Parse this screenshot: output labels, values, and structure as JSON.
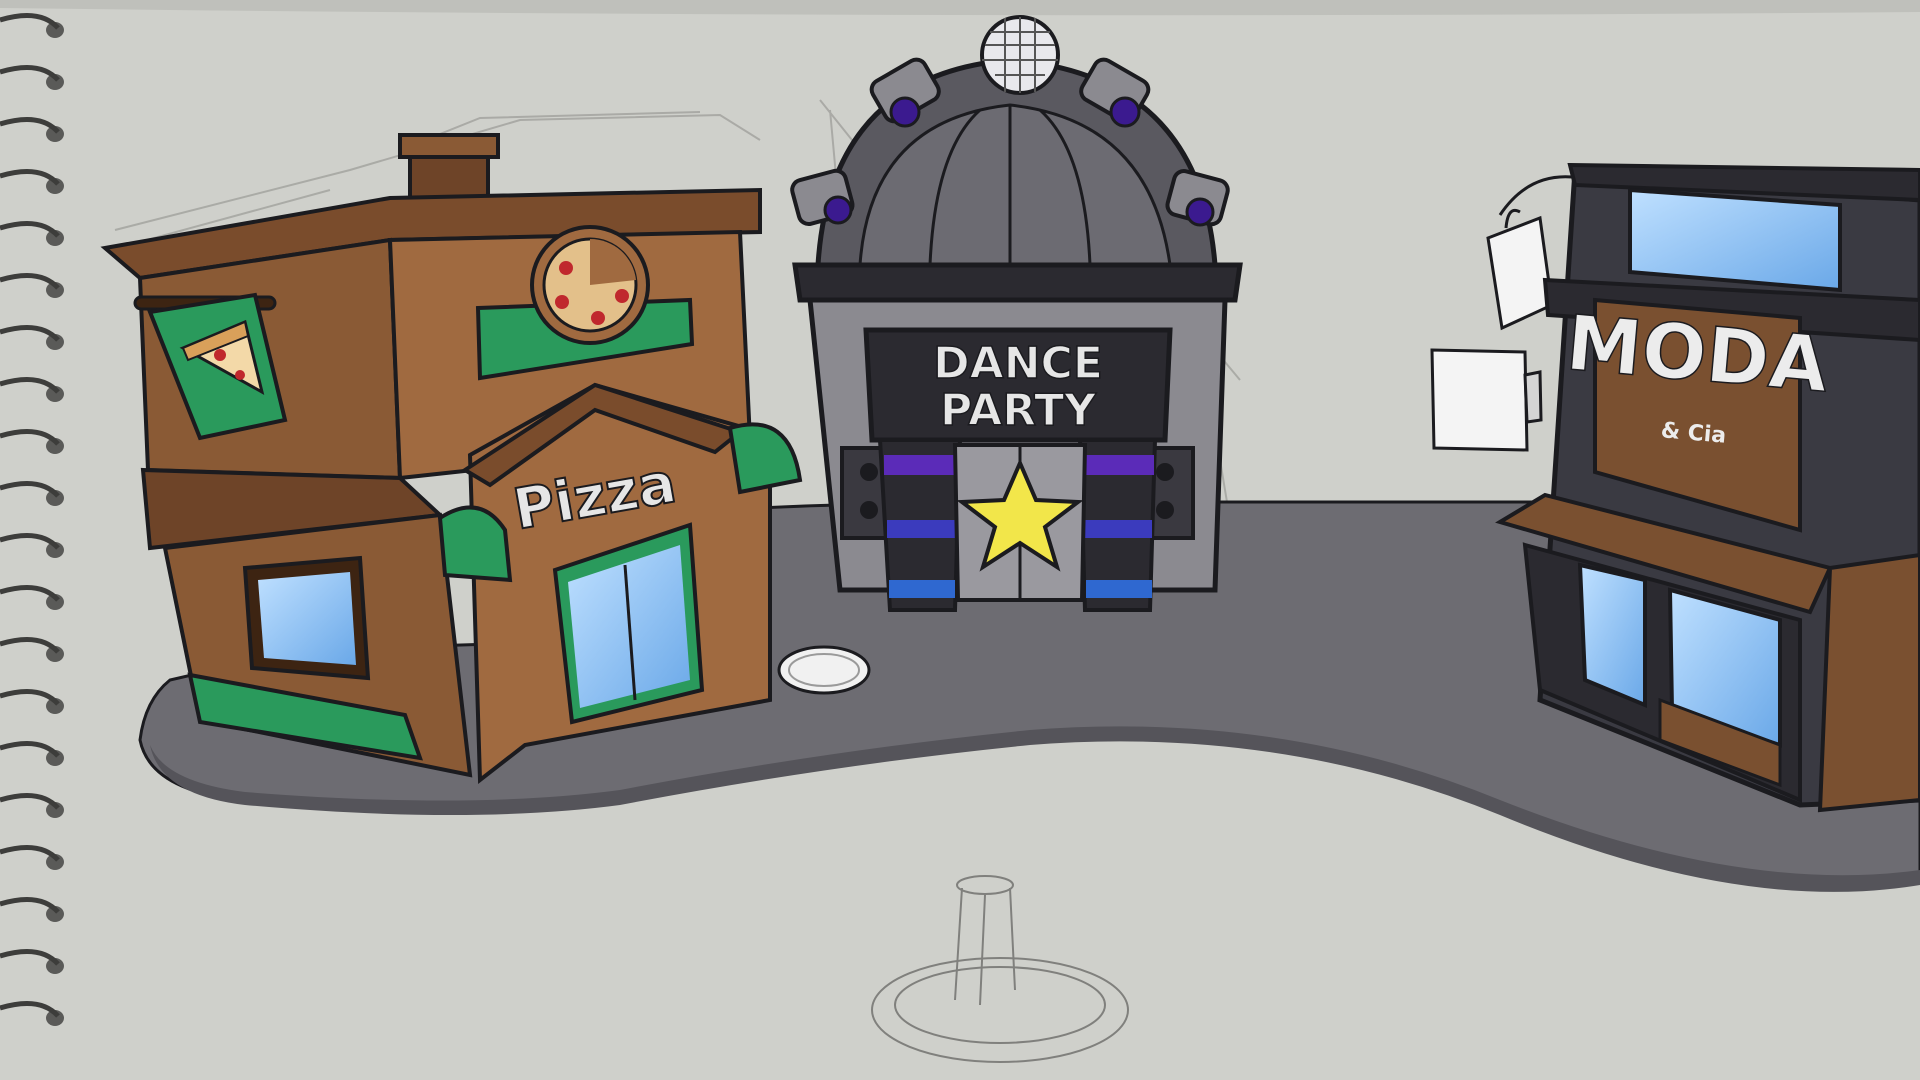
{
  "scene": {
    "paper_color": "#cfd0cb",
    "road_color": "#6d6c72",
    "outline_color": "#1b1b1f"
  },
  "buildings": {
    "pizza": {
      "sign_label": "Pizza",
      "wall_color": "#8a5a35",
      "accent_color": "#2a9a5c",
      "icons": [
        "pizza-slice-icon",
        "pizza-icon"
      ]
    },
    "dance": {
      "sign_line1": "DANCE",
      "sign_line2": "PARTY",
      "wall_color": "#8b8a90",
      "accent_color": "#5b2bb8",
      "icons": [
        "disco-ball-icon",
        "star-icon",
        "spotlight-icon",
        "speaker-icon"
      ]
    },
    "moda": {
      "sign_label": "MODA",
      "sign_sub": "& Cia",
      "wall_color": "#3a3a42",
      "accent_color": "#7a5030",
      "icons": [
        "shopping-bag-icon"
      ]
    }
  },
  "props": {
    "icons": [
      "manhole-cover-icon",
      "fountain-sketch-icon",
      "spiral-binding-icon"
    ]
  }
}
